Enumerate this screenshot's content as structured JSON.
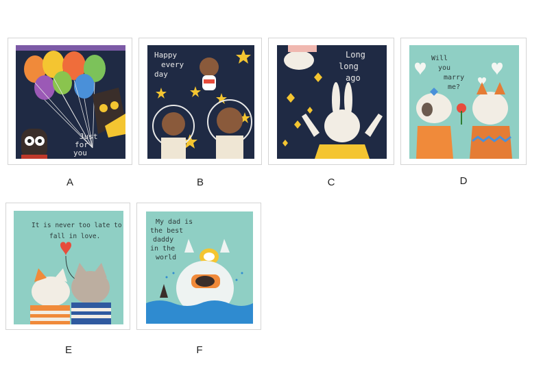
{
  "options": [
    {
      "label": "A",
      "text": "Just for you",
      "bg": "#1f2a44"
    },
    {
      "label": "B",
      "text": "Happy every day",
      "bg": "#1f2a44"
    },
    {
      "label": "C",
      "text": "Long long ago",
      "bg": "#1f2a44"
    },
    {
      "label": "D",
      "text": "Will you marry me?",
      "bg": "#8fcfc4"
    },
    {
      "label": "E",
      "text": "It is never too late to fall in love.",
      "bg": "#8fcfc4"
    },
    {
      "label": "F",
      "text": "My dad is the best daddy in the world",
      "bg": "#8fcfc4"
    }
  ]
}
